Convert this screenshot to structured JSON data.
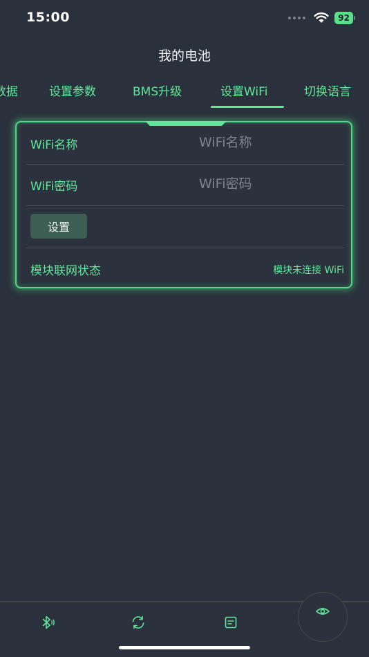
{
  "status_bar": {
    "time": "15:00",
    "battery": "92"
  },
  "header": {
    "title": "我的电池"
  },
  "tabs": [
    {
      "label": "数据"
    },
    {
      "label": "设置参数"
    },
    {
      "label": "BMS升级"
    },
    {
      "label": "设置WiFi",
      "active": true
    },
    {
      "label": "切换语言"
    }
  ],
  "wifi_form": {
    "name_label": "WiFi名称",
    "name_placeholder": "WiFi名称",
    "name_value": "",
    "password_label": "WiFi密码",
    "password_placeholder": "WiFi密码",
    "password_value": "",
    "set_button": "设置",
    "status_label": "模块联网状态",
    "status_value": "模块未连接 WiFi"
  },
  "bottom_nav": {
    "items": [
      {
        "icon": "bluetooth-icon"
      },
      {
        "icon": "refresh-icon"
      },
      {
        "icon": "document-icon"
      },
      {
        "icon": "eye-icon"
      }
    ]
  },
  "colors": {
    "accent": "#5fe89a",
    "background": "#2b313c"
  }
}
